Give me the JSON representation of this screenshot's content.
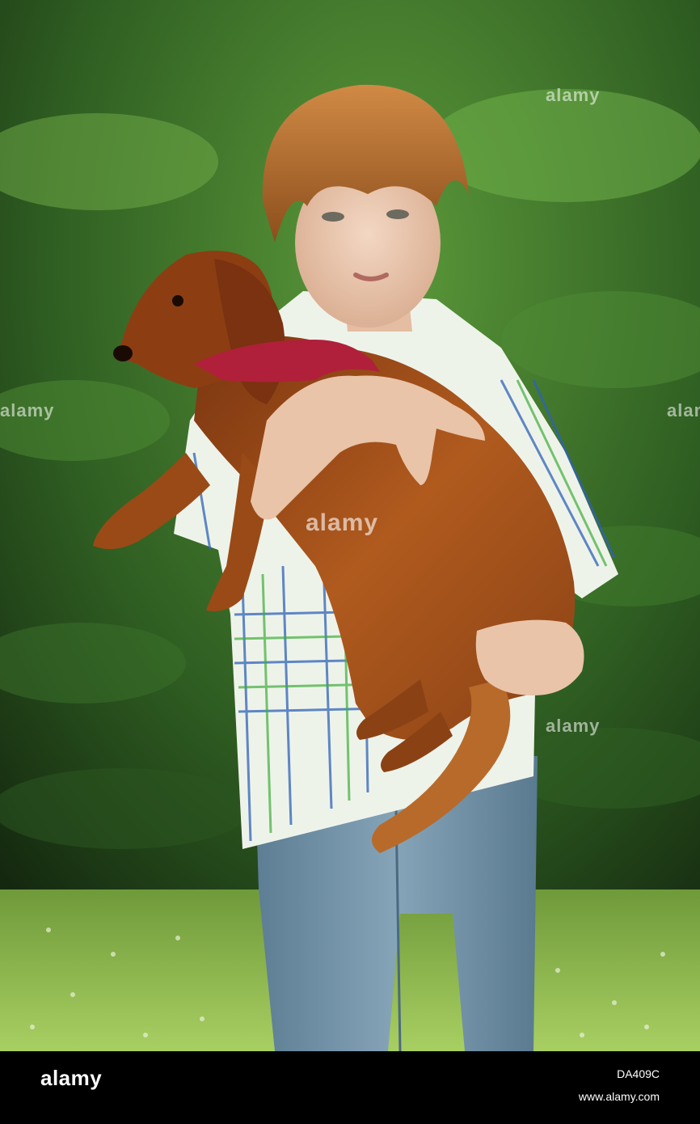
{
  "watermark": {
    "text": "alamy"
  },
  "footer": {
    "logo": "alamy",
    "image_id": "DA409C",
    "site": "www.alamy.com"
  },
  "colors": {
    "background_dark": "#1f3a16",
    "foliage": "#3f7a2c",
    "grass": "#8fbf4e",
    "dog_fur": "#9a4a16",
    "jeans": "#6f8fa5",
    "shirt": "#e8efe6",
    "hair": "#b56a2a"
  }
}
